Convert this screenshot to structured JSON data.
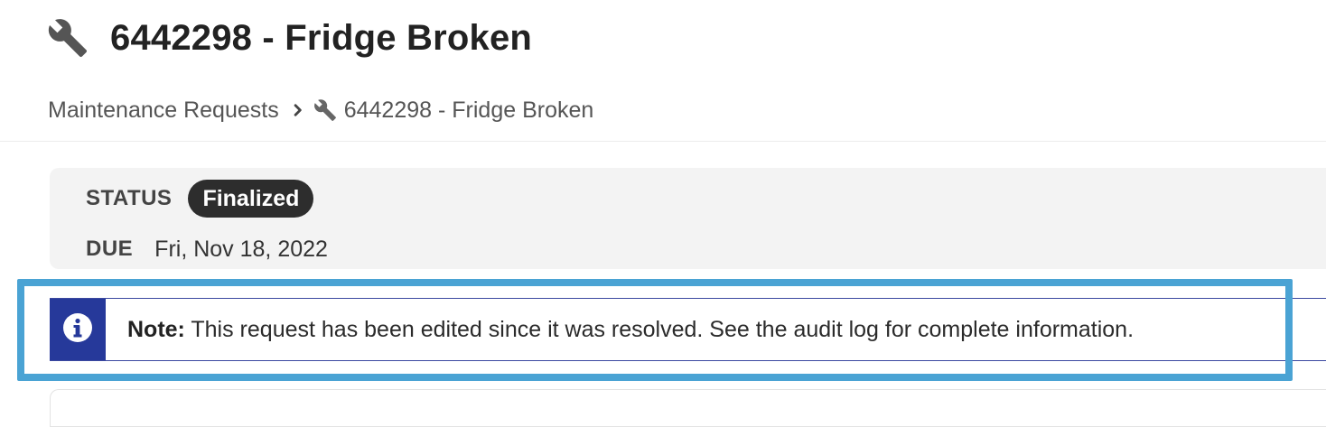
{
  "header": {
    "title": "6442298 - Fridge Broken",
    "icon": "wrench-icon"
  },
  "breadcrumb": {
    "parent": "Maintenance Requests",
    "separator_icon": "chevron-right-icon",
    "current_icon": "wrench-icon",
    "current": "6442298 - Fridge Broken"
  },
  "details": {
    "status_label": "STATUS",
    "status_value": "Finalized",
    "due_label": "DUE",
    "due_value": "Fri, Nov 18, 2022"
  },
  "notice": {
    "icon": "info-icon",
    "label": "Note:",
    "message": " This request has been edited since it was resolved. See the audit log for complete information."
  },
  "colors": {
    "highlight": "#4aa3d4",
    "notice_accent": "#26399a",
    "badge_bg": "#2d2d2d",
    "card_bg": "#f3f3f3"
  }
}
